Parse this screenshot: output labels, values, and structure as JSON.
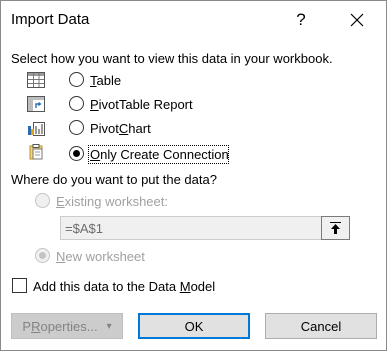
{
  "dialog": {
    "title": "Import Data",
    "help_glyph": "?",
    "close_icon": "close-icon"
  },
  "view_section": {
    "prompt": "Select how you want to view this data in your workbook.",
    "options": [
      {
        "label": "Table",
        "access_key": "T",
        "icon": "table-icon",
        "selected": false
      },
      {
        "label": "PivotTable Report",
        "access_key": "P",
        "icon": "pivottable-icon",
        "selected": false
      },
      {
        "label": "PivotChart",
        "access_key": "C",
        "icon": "pivotchart-icon",
        "selected": false
      },
      {
        "label": "Only Create Connection",
        "access_key": "O",
        "icon": "connection-icon",
        "selected": true
      }
    ]
  },
  "location_section": {
    "prompt": "Where do you want to put the data?",
    "existing_label": "Existing worksheet:",
    "existing_access_key": "E",
    "cell_value": "=$A$1",
    "collapse_icon": "collapse-arrow-icon",
    "new_label": "New worksheet",
    "new_access_key": "N",
    "new_selected": true,
    "enabled": false
  },
  "data_model": {
    "label": "Add this data to the Data Model",
    "access_key": "M",
    "checked": false
  },
  "buttons": {
    "properties": "Properties...",
    "properties_access_key": "R",
    "properties_arrow": "▾",
    "ok": "OK",
    "cancel": "Cancel"
  }
}
